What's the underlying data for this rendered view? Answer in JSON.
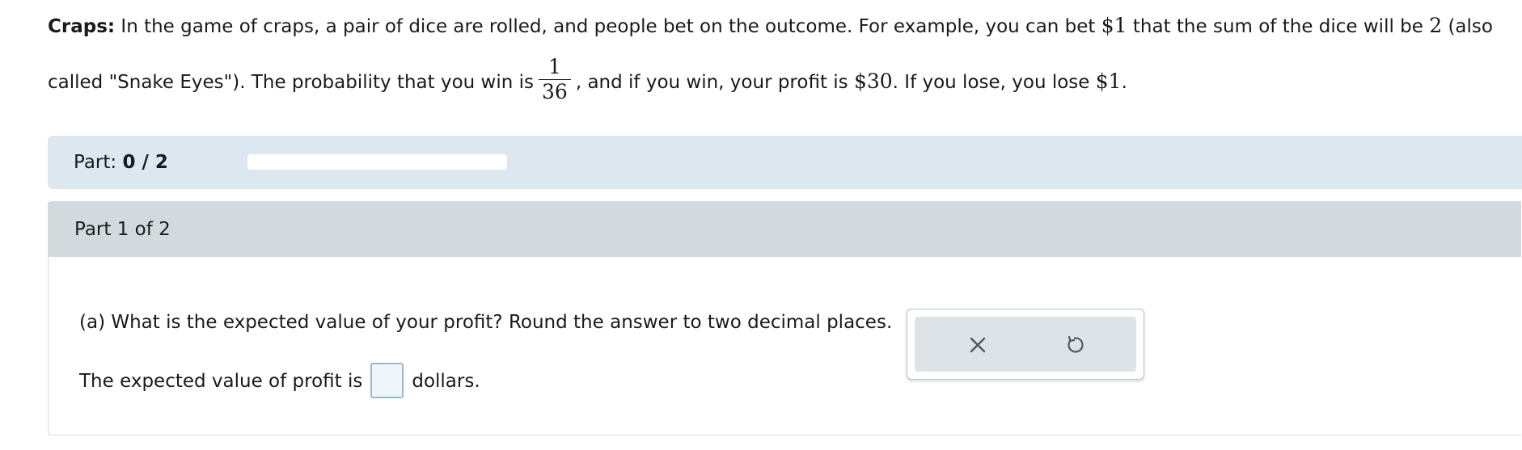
{
  "problem": {
    "title": "Craps:",
    "text1": " In the game of craps, a pair of dice are rolled, and people bet on the outcome. For example, you can bet ",
    "bet_amount": "$1",
    "text2": " that the sum of the dice will be ",
    "sum_value": "2",
    "text3": " (also",
    "text4": "called \"Snake Eyes\"). The probability that you win is",
    "prob_num": "1",
    "prob_den": "36",
    "text5": ", and if you win, your profit is ",
    "profit": "$30",
    "text6": ". If you lose, you lose ",
    "loss": "$1",
    "text7": "."
  },
  "part_bar": {
    "label": "Part: ",
    "progress": "0 / 2",
    "progress_fraction": 0
  },
  "part": {
    "title": "Part 1 of 2",
    "question": "(a) What is the expected value of your profit? Round the answer to two decimal places.",
    "answer_prefix": "The expected value of profit is",
    "answer_value": "",
    "answer_suffix": "dollars."
  },
  "actions": {
    "clear_icon": "close-icon",
    "reset_icon": "undo-icon"
  },
  "colors": {
    "part_bar_bg": "#dde7ef",
    "part_header_bg": "#d3dade",
    "input_border": "#9bb8cc"
  }
}
